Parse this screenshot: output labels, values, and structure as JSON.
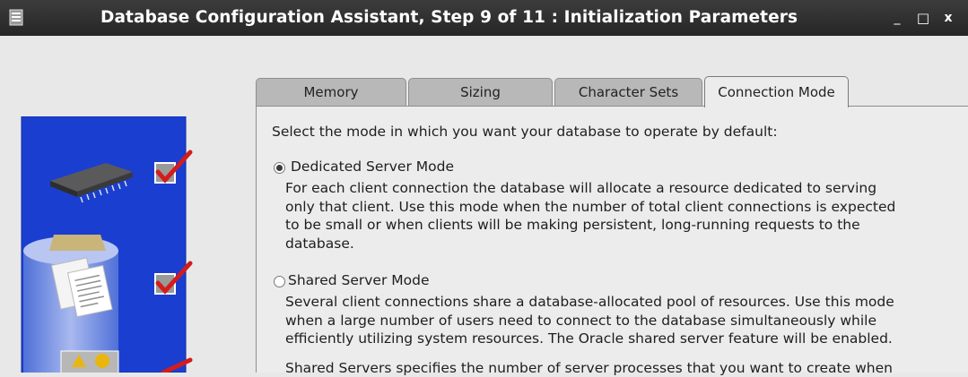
{
  "window": {
    "title": "Database Configuration Assistant, Step 9 of 11 : Initialization Parameters",
    "minimize": "_",
    "maximize": "□",
    "close": "x"
  },
  "tabs": [
    {
      "label": "Memory",
      "active": false
    },
    {
      "label": "Sizing",
      "active": false
    },
    {
      "label": "Character Sets",
      "active": false
    },
    {
      "label": "Connection Mode",
      "active": true
    }
  ],
  "panel": {
    "prompt": "Select the mode in which you want your database to operate by default:",
    "options": [
      {
        "label": "Dedicated Server Mode",
        "selected": true,
        "description": [
          "For each client connection the database will allocate a resource dedicated to serving",
          "only that client.  Use this mode when the number of total client connections is expected",
          "to be small or when clients will be making persistent, long-running requests to the",
          "database."
        ]
      },
      {
        "label": "Shared Server Mode",
        "selected": false,
        "description": [
          "Several client connections share a database-allocated pool of resources.  Use this mode",
          "when a large number of users need to connect to the database simultaneously while",
          "efficiently utilizing system resources.  The Oracle shared server feature will be enabled.",
          "Shared Servers specifies the number of server processes that you want to create when"
        ]
      }
    ]
  },
  "icons": {
    "app": "app-icon",
    "steps": [
      "memory-chip-icon",
      "database-folder-icon",
      "shapes-icon"
    ],
    "check": "red-checkmark-icon"
  },
  "colors": {
    "titlebar": "#2f2f2f",
    "graphic_blue": "#1a3fd0",
    "check_red": "#d41c1c"
  }
}
